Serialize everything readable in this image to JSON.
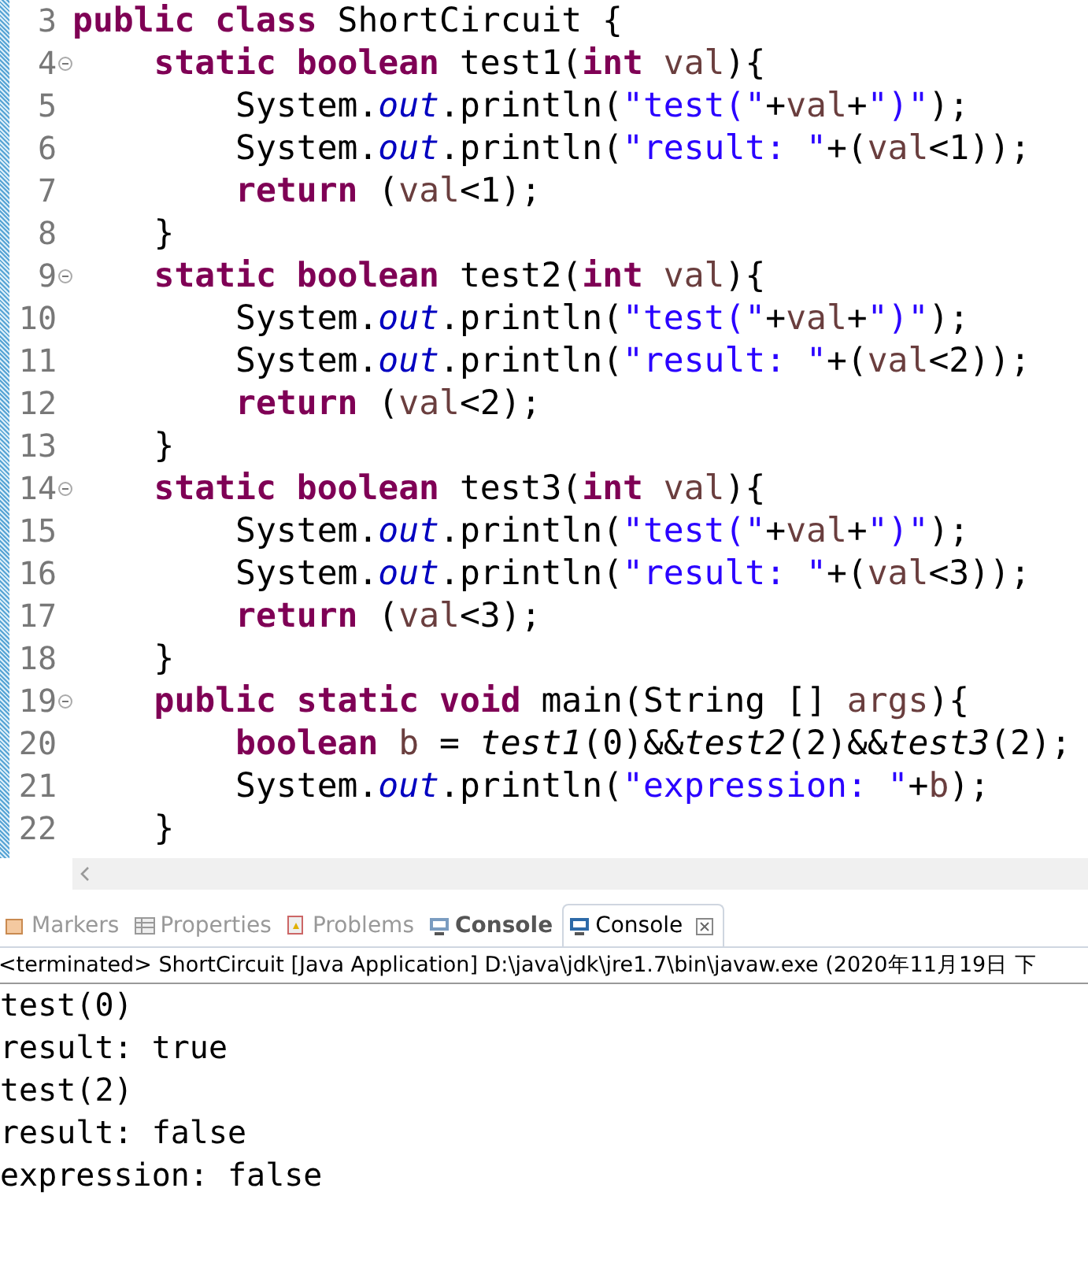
{
  "editor": {
    "lines": [
      {
        "number": "3",
        "fold": false,
        "tokens": [
          {
            "kind": "kw",
            "t": "public class "
          },
          {
            "kind": "txt",
            "t": "ShortCircuit {"
          }
        ]
      },
      {
        "number": "4",
        "fold": true,
        "tokens": [
          {
            "kind": "kw",
            "t": "    static boolean "
          },
          {
            "kind": "txt",
            "t": "test1("
          },
          {
            "kind": "kw",
            "t": "int "
          },
          {
            "kind": "var",
            "t": "val"
          },
          {
            "kind": "txt",
            "t": "){"
          }
        ]
      },
      {
        "number": "5",
        "fold": false,
        "tokens": [
          {
            "kind": "txt",
            "t": "        System."
          },
          {
            "kind": "fld",
            "t": "out"
          },
          {
            "kind": "txt",
            "t": ".println("
          },
          {
            "kind": "str",
            "t": "\"test(\""
          },
          {
            "kind": "txt",
            "t": "+"
          },
          {
            "kind": "var",
            "t": "val"
          },
          {
            "kind": "txt",
            "t": "+"
          },
          {
            "kind": "str",
            "t": "\")\""
          },
          {
            "kind": "txt",
            "t": ");"
          }
        ]
      },
      {
        "number": "6",
        "fold": false,
        "tokens": [
          {
            "kind": "txt",
            "t": "        System."
          },
          {
            "kind": "fld",
            "t": "out"
          },
          {
            "kind": "txt",
            "t": ".println("
          },
          {
            "kind": "str",
            "t": "\"result: \""
          },
          {
            "kind": "txt",
            "t": "+("
          },
          {
            "kind": "var",
            "t": "val"
          },
          {
            "kind": "txt",
            "t": "<1));"
          }
        ]
      },
      {
        "number": "7",
        "fold": false,
        "tokens": [
          {
            "kind": "kw",
            "t": "        return "
          },
          {
            "kind": "txt",
            "t": "("
          },
          {
            "kind": "var",
            "t": "val"
          },
          {
            "kind": "txt",
            "t": "<1);"
          }
        ]
      },
      {
        "number": "8",
        "fold": false,
        "tokens": [
          {
            "kind": "txt",
            "t": "    }"
          }
        ]
      },
      {
        "number": "9",
        "fold": true,
        "tokens": [
          {
            "kind": "kw",
            "t": "    static boolean "
          },
          {
            "kind": "txt",
            "t": "test2("
          },
          {
            "kind": "kw",
            "t": "int "
          },
          {
            "kind": "var",
            "t": "val"
          },
          {
            "kind": "txt",
            "t": "){"
          }
        ]
      },
      {
        "number": "10",
        "fold": false,
        "tokens": [
          {
            "kind": "txt",
            "t": "        System."
          },
          {
            "kind": "fld",
            "t": "out"
          },
          {
            "kind": "txt",
            "t": ".println("
          },
          {
            "kind": "str",
            "t": "\"test(\""
          },
          {
            "kind": "txt",
            "t": "+"
          },
          {
            "kind": "var",
            "t": "val"
          },
          {
            "kind": "txt",
            "t": "+"
          },
          {
            "kind": "str",
            "t": "\")\""
          },
          {
            "kind": "txt",
            "t": ");"
          }
        ]
      },
      {
        "number": "11",
        "fold": false,
        "tokens": [
          {
            "kind": "txt",
            "t": "        System."
          },
          {
            "kind": "fld",
            "t": "out"
          },
          {
            "kind": "txt",
            "t": ".println("
          },
          {
            "kind": "str",
            "t": "\"result: \""
          },
          {
            "kind": "txt",
            "t": "+("
          },
          {
            "kind": "var",
            "t": "val"
          },
          {
            "kind": "txt",
            "t": "<2));"
          }
        ]
      },
      {
        "number": "12",
        "fold": false,
        "tokens": [
          {
            "kind": "kw",
            "t": "        return "
          },
          {
            "kind": "txt",
            "t": "("
          },
          {
            "kind": "var",
            "t": "val"
          },
          {
            "kind": "txt",
            "t": "<2);"
          }
        ]
      },
      {
        "number": "13",
        "fold": false,
        "tokens": [
          {
            "kind": "txt",
            "t": "    }"
          }
        ]
      },
      {
        "number": "14",
        "fold": true,
        "tokens": [
          {
            "kind": "kw",
            "t": "    static boolean "
          },
          {
            "kind": "txt",
            "t": "test3("
          },
          {
            "kind": "kw",
            "t": "int "
          },
          {
            "kind": "var",
            "t": "val"
          },
          {
            "kind": "txt",
            "t": "){"
          }
        ]
      },
      {
        "number": "15",
        "fold": false,
        "tokens": [
          {
            "kind": "txt",
            "t": "        System."
          },
          {
            "kind": "fld",
            "t": "out"
          },
          {
            "kind": "txt",
            "t": ".println("
          },
          {
            "kind": "str",
            "t": "\"test(\""
          },
          {
            "kind": "txt",
            "t": "+"
          },
          {
            "kind": "var",
            "t": "val"
          },
          {
            "kind": "txt",
            "t": "+"
          },
          {
            "kind": "str",
            "t": "\")\""
          },
          {
            "kind": "txt",
            "t": ");"
          }
        ]
      },
      {
        "number": "16",
        "fold": false,
        "tokens": [
          {
            "kind": "txt",
            "t": "        System."
          },
          {
            "kind": "fld",
            "t": "out"
          },
          {
            "kind": "txt",
            "t": ".println("
          },
          {
            "kind": "str",
            "t": "\"result: \""
          },
          {
            "kind": "txt",
            "t": "+("
          },
          {
            "kind": "var",
            "t": "val"
          },
          {
            "kind": "txt",
            "t": "<3));"
          }
        ]
      },
      {
        "number": "17",
        "fold": false,
        "tokens": [
          {
            "kind": "kw",
            "t": "        return "
          },
          {
            "kind": "txt",
            "t": "("
          },
          {
            "kind": "var",
            "t": "val"
          },
          {
            "kind": "txt",
            "t": "<3);"
          }
        ]
      },
      {
        "number": "18",
        "fold": false,
        "tokens": [
          {
            "kind": "txt",
            "t": "    }"
          }
        ]
      },
      {
        "number": "19",
        "fold": true,
        "tokens": [
          {
            "kind": "kw",
            "t": "    public static void "
          },
          {
            "kind": "txt",
            "t": "main(String [] "
          },
          {
            "kind": "var",
            "t": "args"
          },
          {
            "kind": "txt",
            "t": "){"
          }
        ]
      },
      {
        "number": "20",
        "fold": false,
        "tokens": [
          {
            "kind": "kw",
            "t": "        boolean "
          },
          {
            "kind": "var",
            "t": "b"
          },
          {
            "kind": "txt",
            "t": " = "
          },
          {
            "kind": "call",
            "t": "test1"
          },
          {
            "kind": "txt",
            "t": "(0)&&"
          },
          {
            "kind": "call",
            "t": "test2"
          },
          {
            "kind": "txt",
            "t": "(2)&&"
          },
          {
            "kind": "call",
            "t": "test3"
          },
          {
            "kind": "txt",
            "t": "(2);"
          }
        ]
      },
      {
        "number": "21",
        "fold": false,
        "tokens": [
          {
            "kind": "txt",
            "t": "        System."
          },
          {
            "kind": "fld",
            "t": "out"
          },
          {
            "kind": "txt",
            "t": ".println("
          },
          {
            "kind": "str",
            "t": "\"expression: \""
          },
          {
            "kind": "txt",
            "t": "+"
          },
          {
            "kind": "var",
            "t": "b"
          },
          {
            "kind": "txt",
            "t": ");"
          }
        ]
      },
      {
        "number": "22",
        "fold": false,
        "tokens": [
          {
            "kind": "txt",
            "t": "    }"
          }
        ]
      }
    ]
  },
  "views": {
    "tabs": [
      {
        "label": "Markers",
        "kind": "markers",
        "selected": false,
        "bold": false
      },
      {
        "label": "Properties",
        "kind": "properties",
        "selected": false,
        "bold": false
      },
      {
        "label": "Problems",
        "kind": "problems",
        "selected": false,
        "bold": false
      },
      {
        "label": "Console",
        "kind": "console",
        "selected": false,
        "bold": true
      },
      {
        "label": "Console",
        "kind": "console",
        "selected": true,
        "bold": false
      }
    ]
  },
  "console": {
    "status": "<terminated> ShortCircuit [Java Application] D:\\java\\jdk\\jre1.7\\bin\\javaw.exe (2020年11月19日 下",
    "output": [
      "test(0)",
      "result: true",
      "test(2)",
      "result: false",
      "expression: false"
    ]
  }
}
